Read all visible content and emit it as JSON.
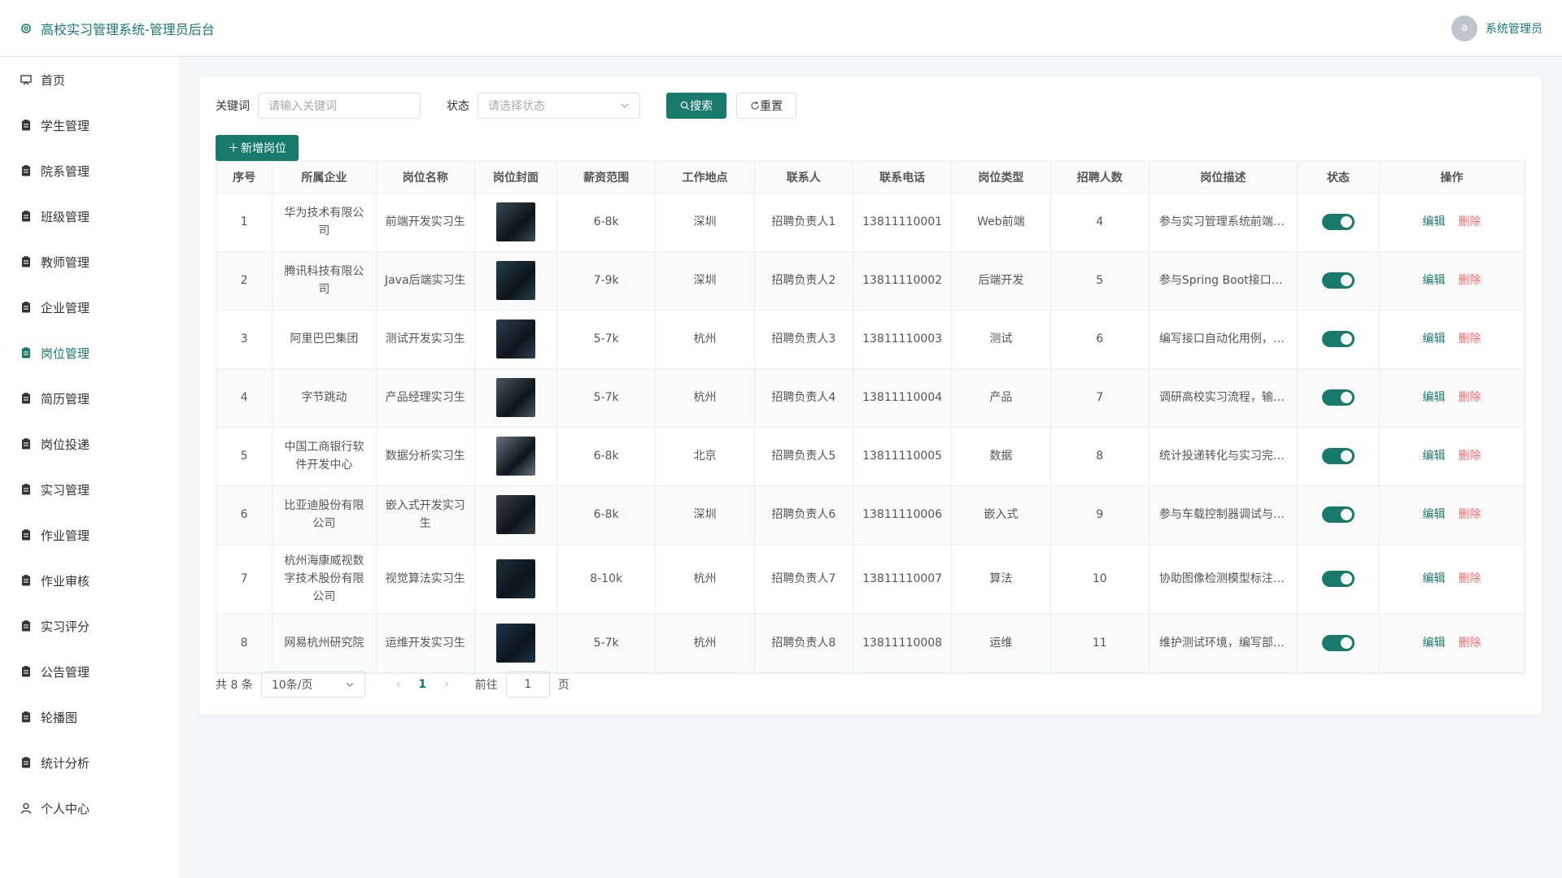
{
  "header": {
    "title": "高校实习管理系统-管理员后台",
    "avatar_letter": "a",
    "user_name": "系统管理员"
  },
  "sidebar": {
    "items": [
      {
        "label": "首页",
        "icon": "home-icon"
      },
      {
        "label": "学生管理",
        "icon": "clipboard-icon"
      },
      {
        "label": "院系管理",
        "icon": "clipboard-icon"
      },
      {
        "label": "班级管理",
        "icon": "clipboard-icon"
      },
      {
        "label": "教师管理",
        "icon": "clipboard-icon"
      },
      {
        "label": "企业管理",
        "icon": "clipboard-icon"
      },
      {
        "label": "岗位管理",
        "icon": "clipboard-icon",
        "active": true
      },
      {
        "label": "简历管理",
        "icon": "clipboard-icon"
      },
      {
        "label": "岗位投递",
        "icon": "clipboard-icon"
      },
      {
        "label": "实习管理",
        "icon": "clipboard-icon"
      },
      {
        "label": "作业管理",
        "icon": "clipboard-icon"
      },
      {
        "label": "作业审核",
        "icon": "clipboard-icon"
      },
      {
        "label": "实习评分",
        "icon": "clipboard-icon"
      },
      {
        "label": "公告管理",
        "icon": "clipboard-icon"
      },
      {
        "label": "轮播图",
        "icon": "clipboard-icon"
      },
      {
        "label": "统计分析",
        "icon": "clipboard-icon"
      },
      {
        "label": "个人中心",
        "icon": "user-icon"
      }
    ]
  },
  "search": {
    "keyword_label": "关键词",
    "keyword_placeholder": "请输入关键词",
    "status_label": "状态",
    "status_placeholder": "请选择状态",
    "search_button": "搜索",
    "reset_button": "重置",
    "add_button": "新增岗位"
  },
  "table": {
    "columns": [
      "序号",
      "所属企业",
      "岗位名称",
      "岗位封面",
      "薪资范围",
      "工作地点",
      "联系人",
      "联系电话",
      "岗位类型",
      "招聘人数",
      "岗位描述",
      "状态",
      "操作"
    ],
    "edit_label": "编辑",
    "delete_label": "删除",
    "rows": [
      {
        "no": "1",
        "company": "华为技术有限公司",
        "position": "前端开发实习生",
        "salary": "6-8k",
        "location": "深圳",
        "contact": "招聘负责人1",
        "phone": "13811110001",
        "type": "Web前端",
        "count": "4",
        "desc": "参与实习管理系统前端页面开发",
        "status": true,
        "thumb_color": "#3b4a52"
      },
      {
        "no": "2",
        "company": "腾讯科技有限公司",
        "position": "Java后端实习生",
        "salary": "7-9k",
        "location": "深圳",
        "contact": "招聘负责人2",
        "phone": "13811110002",
        "type": "后端开发",
        "count": "5",
        "desc": "参与Spring Boot接口开发",
        "status": true,
        "thumb_color": "#23404a"
      },
      {
        "no": "3",
        "company": "阿里巴巴集团",
        "position": "测试开发实习生",
        "salary": "5-7k",
        "location": "杭州",
        "contact": "招聘负责人3",
        "phone": "13811110003",
        "type": "测试",
        "count": "6",
        "desc": "编写接口自动化用例，完成测试",
        "status": true,
        "thumb_color": "#2e3f52"
      },
      {
        "no": "4",
        "company": "字节跳动",
        "position": "产品经理实习生",
        "salary": "5-7k",
        "location": "杭州",
        "contact": "招聘负责人4",
        "phone": "13811110004",
        "type": "产品",
        "count": "7",
        "desc": "调研高校实习流程，输出需求文档",
        "status": true,
        "thumb_color": "#4d5660"
      },
      {
        "no": "5",
        "company": "中国工商银行软件开发中心",
        "position": "数据分析实习生",
        "salary": "6-8k",
        "location": "北京",
        "contact": "招聘负责人5",
        "phone": "13811110005",
        "type": "数据",
        "count": "8",
        "desc": "统计投递转化与实习完成情况",
        "status": true,
        "thumb_color": "#6a7580"
      },
      {
        "no": "6",
        "company": "比亚迪股份有限公司",
        "position": "嵌入式开发实习生",
        "salary": "6-8k",
        "location": "深圳",
        "contact": "招聘负责人6",
        "phone": "13811110006",
        "type": "嵌入式",
        "count": "9",
        "desc": "参与车载控制器调试与测试",
        "status": true,
        "thumb_color": "#3a3f46"
      },
      {
        "no": "7",
        "company": "杭州海康威视数字技术股份有限公司",
        "position": "视觉算法实习生",
        "salary": "8-10k",
        "location": "杭州",
        "contact": "招聘负责人7",
        "phone": "13811110007",
        "type": "算法",
        "count": "10",
        "desc": "协助图像检测模型标注与训练",
        "status": true,
        "thumb_color": "#1f2f3c"
      },
      {
        "no": "8",
        "company": "网易杭州研究院",
        "position": "运维开发实习生",
        "salary": "5-7k",
        "location": "杭州",
        "contact": "招聘负责人8",
        "phone": "13811110008",
        "type": "运维",
        "count": "11",
        "desc": "维护测试环境，编写部署脚本",
        "status": true,
        "thumb_color": "#1c3550"
      }
    ]
  },
  "pagination": {
    "total_text": "共 8 条",
    "page_size": "10条/页",
    "current_page": "1",
    "goto_label": "前往",
    "goto_value": "1",
    "page_suffix": "页"
  },
  "colors": {
    "accent": "#177a6b",
    "danger": "#f56c6c"
  }
}
